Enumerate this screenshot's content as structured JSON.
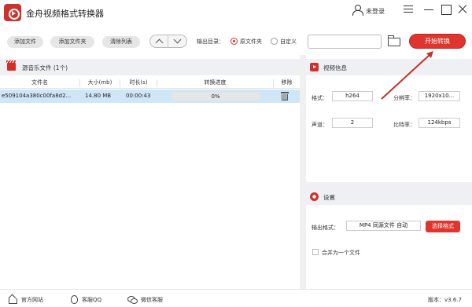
{
  "app": {
    "title": "金舟视频格式转换器"
  },
  "header": {
    "user_label": "未登录"
  },
  "toolbar": {
    "add_file": "添加文件",
    "add_folder": "添加文件夹",
    "clear_list": "清除列表",
    "output_dir_label": "输出目录：",
    "radio_source": "原文件夹",
    "radio_custom": "自定义",
    "selected_output": "原文件夹",
    "path_value": "",
    "start_button": "开始转换"
  },
  "file_list": {
    "title": "源音乐文件 (1个)",
    "columns": [
      "文件名",
      "大小(mb)",
      "时长(s)",
      "转换进度",
      "移除"
    ],
    "rows": [
      {
        "name": "e509104a380c00fa8d2...",
        "size": "14.80 MB",
        "duration": "00:00:43",
        "progress_label": "0%",
        "progress": 0
      }
    ]
  },
  "video_info": {
    "title": "视频信息",
    "format_label": "格式：",
    "format_value": "h264",
    "resolution_label": "分辨率：",
    "resolution_value": "1920x10...",
    "channel_label": "声道：",
    "channel_value": "2",
    "bitrate_label": "比特率：",
    "bitrate_value": "124kbps"
  },
  "settings": {
    "title": "设置",
    "output_format_label": "输出格式：",
    "output_format_value": "MP4 同源文件 自动",
    "select_format_button": "选择格式",
    "merge_label": "合并为一个文件",
    "merge_checked": false
  },
  "footer": {
    "website": "官方网站",
    "qq": "客服QQ",
    "wechat": "微信客服",
    "version": "版本：v3.6.7"
  },
  "colors": {
    "accent": "#e0352e",
    "selected_row": "#cfe6f7",
    "panel_header": "#eef0f3"
  }
}
